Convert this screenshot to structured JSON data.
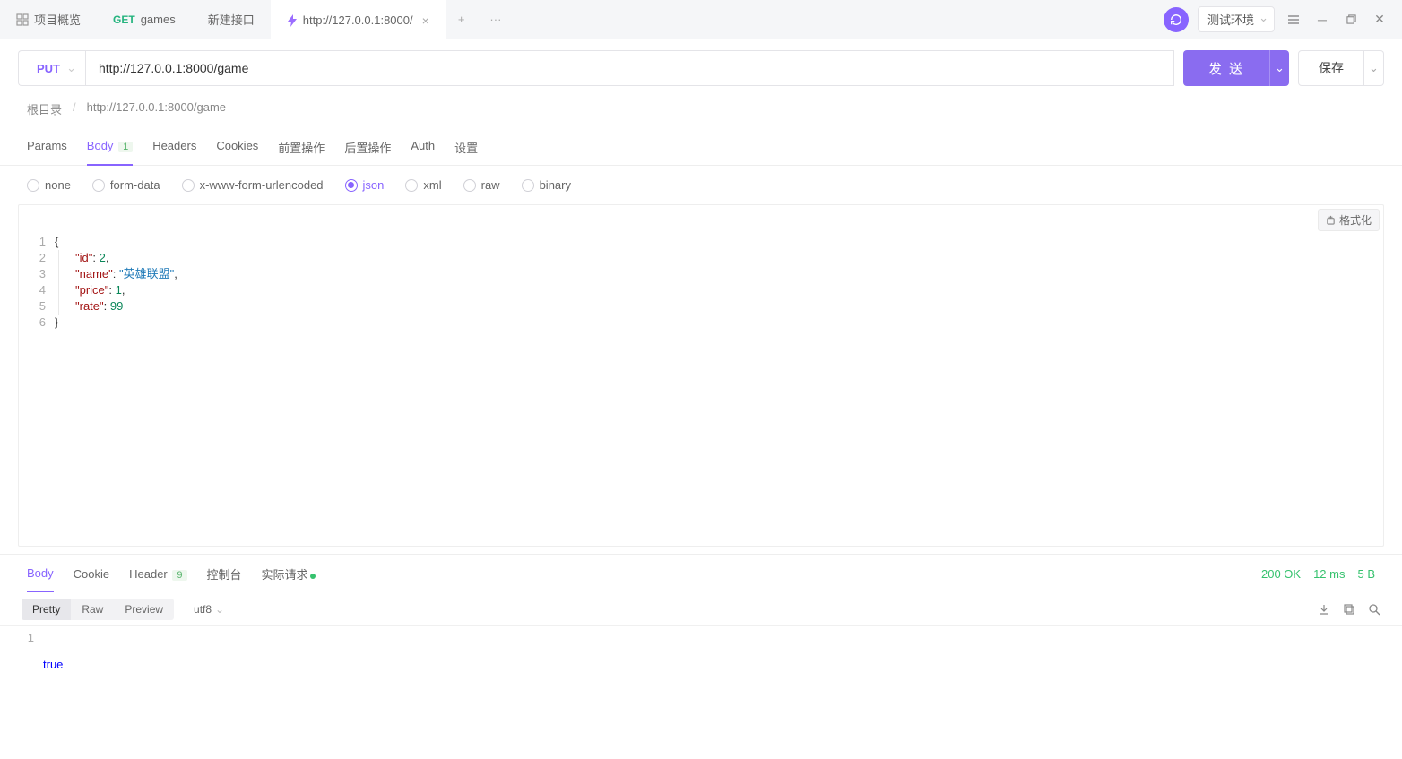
{
  "tabs": {
    "overview": "项目概览",
    "games_method": "GET",
    "games_label": "games",
    "new_api": "新建接口",
    "active_label": "http://127.0.0.1:8000/"
  },
  "topbar": {
    "env": "测试环境"
  },
  "request": {
    "method": "PUT",
    "url": "http://127.0.0.1:8000/game",
    "send": "发 送",
    "save": "保存"
  },
  "breadcrumb": {
    "root": "根目录",
    "path": "http://127.0.0.1:8000/game"
  },
  "req_tabs": {
    "params": "Params",
    "body": "Body",
    "body_badge": "1",
    "headers": "Headers",
    "cookies": "Cookies",
    "pre": "前置操作",
    "post": "后置操作",
    "auth": "Auth",
    "settings": "设置"
  },
  "body_types": {
    "none": "none",
    "form_data": "form-data",
    "xwww": "x-www-form-urlencoded",
    "json": "json",
    "xml": "xml",
    "raw": "raw",
    "binary": "binary"
  },
  "editor": {
    "format": "格式化",
    "lines": [
      "1",
      "2",
      "3",
      "4",
      "5",
      "6"
    ],
    "body_json": {
      "id": 2,
      "name": "英雄联盟",
      "price": 1,
      "rate": 99
    }
  },
  "resp_tabs": {
    "body": "Body",
    "cookie": "Cookie",
    "header": "Header",
    "header_badge": "9",
    "console": "控制台",
    "actual": "实际请求"
  },
  "resp_status": {
    "code": "200 OK",
    "time": "12 ms",
    "size": "5 B"
  },
  "resp_toolbar": {
    "pretty": "Pretty",
    "raw": "Raw",
    "preview": "Preview",
    "enc": "utf8"
  },
  "resp_body": {
    "line_no": "1",
    "value": "true"
  }
}
